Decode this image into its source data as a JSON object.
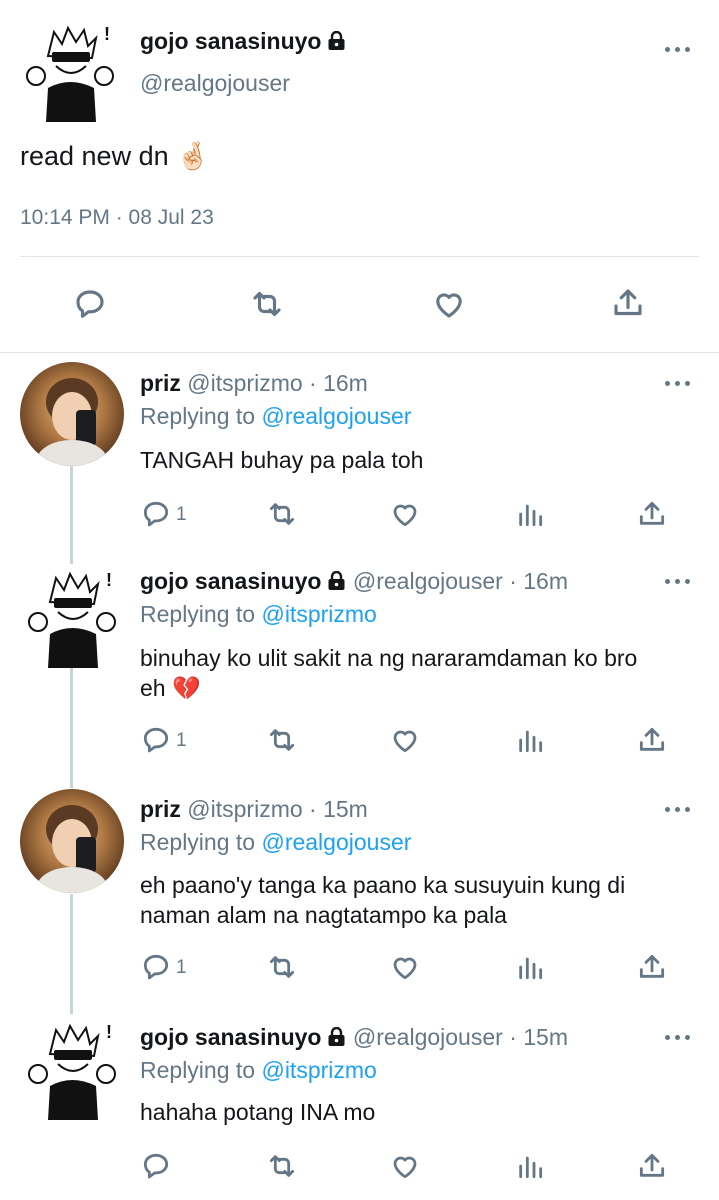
{
  "main_tweet": {
    "name": "gojo sanasinuyo",
    "handle": "@realgojouser",
    "text": "read new dn",
    "emoji": "🤞🏻",
    "timestamp": "10:14 PM · 08 Jul 23"
  },
  "replies": [
    {
      "name": "priz",
      "handle_time": "@itsprizmo · 16m",
      "replying_prefix": "Replying to",
      "replying_to": "@realgojouser",
      "lines": [
        "TANGAH buhay pa pala toh"
      ],
      "reply_count": "1"
    },
    {
      "name": "gojo sanasinuyo",
      "handle_time": "@realgojouser · 16m",
      "replying_prefix": "Replying to",
      "replying_to": "@itsprizmo",
      "lines": [
        "binuhay ko ulit sakit na ng nararamdaman ko bro",
        "eh 💔"
      ],
      "reply_count": "1"
    },
    {
      "name": "priz",
      "handle_time": "@itsprizmo · 15m",
      "replying_prefix": "Replying to",
      "replying_to": "@realgojouser",
      "lines": [
        "eh paano'y tanga ka paano ka susuyuin kung di",
        "naman alam na nagtatampo ka pala"
      ],
      "reply_count": "1"
    },
    {
      "name": "gojo sanasinuyo",
      "handle_time": "@realgojouser · 15m",
      "replying_prefix": "Replying to",
      "replying_to": "@itsprizmo",
      "lines": [
        "hahaha potang INA mo"
      ],
      "reply_count": ""
    }
  ],
  "icons": {
    "reply": "reply-icon",
    "retweet": "retweet-icon",
    "like": "like-icon",
    "share": "share-icon",
    "analytics": "analytics-icon",
    "more": "more-icon",
    "lock": "lock-icon"
  },
  "colors": {
    "text": "#14171a",
    "muted": "#657786",
    "link": "#1da1f2",
    "divider": "#e1e8ed",
    "thread_line": "#c9d3da"
  }
}
